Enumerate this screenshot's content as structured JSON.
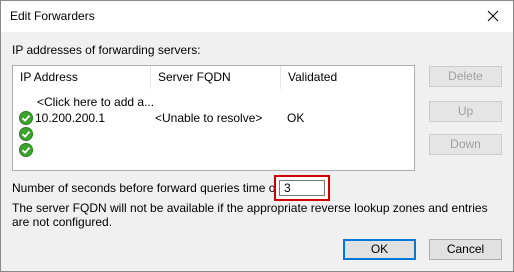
{
  "window": {
    "title": "Edit Forwarders"
  },
  "group": {
    "label": "IP addresses of forwarding servers:"
  },
  "table": {
    "columns": [
      "IP Address",
      "Server FQDN",
      "Validated"
    ],
    "placeholder_row": "<Click here to add a...",
    "rows": [
      {
        "ip": "10.200.200.1",
        "fqdn": "<Unable to resolve>",
        "validated": "OK",
        "status_icon": "green-check-icon"
      },
      {
        "ip": "",
        "fqdn": "",
        "validated": "",
        "status_icon": "green-check-icon"
      },
      {
        "ip": "",
        "fqdn": "",
        "validated": "",
        "status_icon": "green-check-icon"
      }
    ]
  },
  "side_buttons": {
    "delete": "Delete",
    "up": "Up",
    "down": "Down"
  },
  "timeout": {
    "label": "Number of seconds before forward queries time out:",
    "value": "3"
  },
  "note": "The server FQDN will not be available if the appropriate reverse lookup zones and entries are not configured.",
  "footer": {
    "ok": "OK",
    "cancel": "Cancel"
  },
  "colors": {
    "highlight_border": "#d10000",
    "check_green": "#3aa52a",
    "default_button_border": "#0078d7"
  }
}
